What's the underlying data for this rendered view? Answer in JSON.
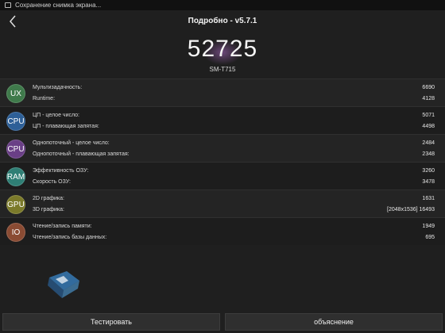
{
  "status_bar": {
    "notification": "Сохранение снимка экрана..."
  },
  "header": {
    "title": "Подробно - v5.7.1"
  },
  "score": "52725",
  "model": "SM-T715",
  "rows": [
    {
      "badge": "UX",
      "color": "#3f7a4b",
      "label1": "Мультизадачность:",
      "value1": "6690",
      "label2": "Runtime:",
      "value2": "4128"
    },
    {
      "badge": "CPU",
      "color": "#2d5f97",
      "label1": "ЦП - целое число:",
      "value1": "5071",
      "label2": "ЦП - плавающая запятая:",
      "value2": "4498"
    },
    {
      "badge": "CPU",
      "color": "#6a3f86",
      "label1": "Однопоточный - целое число:",
      "value1": "2484",
      "label2": "Однопоточный - плавающая запятая:",
      "value2": "2348"
    },
    {
      "badge": "RAM",
      "color": "#2f7f75",
      "label1": "Эффективность ОЗУ:",
      "value1": "3260",
      "label2": "Скорость ОЗУ:",
      "value2": "3478"
    },
    {
      "badge": "GPU",
      "color": "#7b7a2a",
      "label1": "2D графика:",
      "value1": "1631",
      "label2": "3D графика:",
      "value2": "[2048x1536] 16493"
    },
    {
      "badge": "IO",
      "color": "#8a4b33",
      "label1": "Чтение/запись памяти:",
      "value1": "1949",
      "label2": "Чтение/запись базы данных:",
      "value2": "695"
    }
  ],
  "buttons": {
    "test": "Тестировать",
    "explain": "объяснение"
  }
}
